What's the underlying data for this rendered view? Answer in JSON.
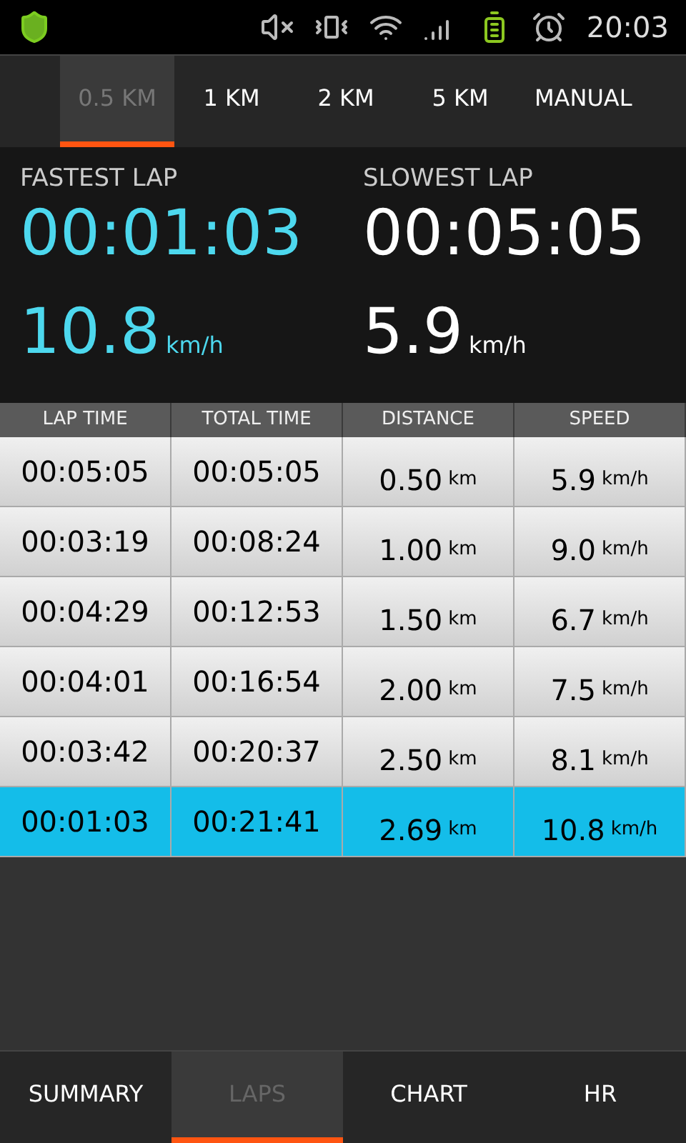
{
  "status_bar": {
    "time": "20:03"
  },
  "interval_tabs": [
    {
      "label": "0.5 KM",
      "selected": true
    },
    {
      "label": "1 KM",
      "selected": false
    },
    {
      "label": "2 KM",
      "selected": false
    },
    {
      "label": "5 KM",
      "selected": false
    },
    {
      "label": "MANUAL",
      "selected": false
    }
  ],
  "fastest_lap": {
    "label": "FASTEST LAP",
    "time": "00:01:03",
    "speed": "10.8",
    "unit": "km/h"
  },
  "slowest_lap": {
    "label": "SLOWEST LAP",
    "time": "00:05:05",
    "speed": "5.9",
    "unit": "km/h"
  },
  "table": {
    "columns": [
      "LAP TIME",
      "TOTAL TIME",
      "DISTANCE",
      "SPEED"
    ],
    "rows": [
      {
        "lap_time": "00:05:05",
        "total_time": "00:05:05",
        "distance": "0.50",
        "distance_unit": "km",
        "speed": "5.9",
        "speed_unit": "km/h",
        "selected": false
      },
      {
        "lap_time": "00:03:19",
        "total_time": "00:08:24",
        "distance": "1.00",
        "distance_unit": "km",
        "speed": "9.0",
        "speed_unit": "km/h",
        "selected": false
      },
      {
        "lap_time": "00:04:29",
        "total_time": "00:12:53",
        "distance": "1.50",
        "distance_unit": "km",
        "speed": "6.7",
        "speed_unit": "km/h",
        "selected": false
      },
      {
        "lap_time": "00:04:01",
        "total_time": "00:16:54",
        "distance": "2.00",
        "distance_unit": "km",
        "speed": "7.5",
        "speed_unit": "km/h",
        "selected": false
      },
      {
        "lap_time": "00:03:42",
        "total_time": "00:20:37",
        "distance": "2.50",
        "distance_unit": "km",
        "speed": "8.1",
        "speed_unit": "km/h",
        "selected": false
      },
      {
        "lap_time": "00:01:03",
        "total_time": "00:21:41",
        "distance": "2.69",
        "distance_unit": "km",
        "speed": "10.8",
        "speed_unit": "km/h",
        "selected": true
      }
    ]
  },
  "bottom_tabs": [
    {
      "label": "SUMMARY",
      "selected": false
    },
    {
      "label": "LAPS",
      "selected": true
    },
    {
      "label": "CHART",
      "selected": false
    },
    {
      "label": "HR",
      "selected": false
    }
  ]
}
